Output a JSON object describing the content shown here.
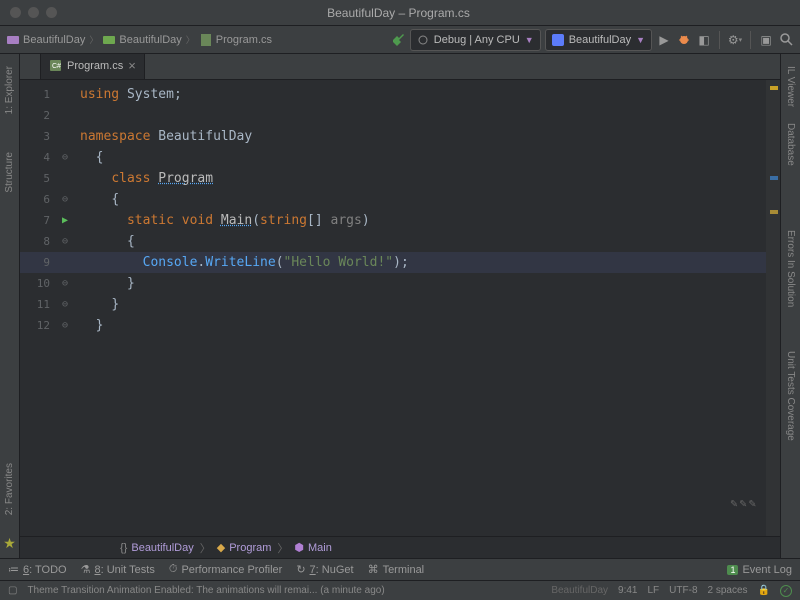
{
  "titlebar": {
    "title": "BeautifulDay – Program.cs"
  },
  "toolbar": {
    "breadcrumbs": [
      {
        "label": "BeautifulDay"
      },
      {
        "label": "BeautifulDay"
      },
      {
        "label": "Program.cs"
      }
    ],
    "config1": "Debug | Any CPU",
    "config2": "BeautifulDay"
  },
  "left_rail": {
    "explorer": "1: Explorer",
    "structure": "Structure",
    "favorites": "2: Favorites"
  },
  "right_rail": {
    "il": "IL Viewer",
    "db": "Database",
    "errors": "Errors In Solution",
    "tests": "Unit Tests Coverage"
  },
  "tab": {
    "label": "Program.cs"
  },
  "code": {
    "l1": {
      "kw": "using",
      "ns": " System",
      "semi": ";"
    },
    "l3": {
      "kw": "namespace",
      "ns": " BeautifulDay"
    },
    "l4": "{",
    "l5": {
      "kw": "class ",
      "name": "Program"
    },
    "l6": "{",
    "l7": {
      "k1": "static ",
      "k2": "void ",
      "m": "Main",
      "p1": "(",
      "t": "string",
      "br": "[]",
      "sp": " ",
      "arg": "args",
      "p2": ")"
    },
    "l8": "{",
    "l9": {
      "cls": "Console",
      "dot": ".",
      "m": "WriteLine",
      "p1": "(",
      "str": "\"Hello World!\"",
      "p2": ")",
      "semi": ";"
    },
    "l10": "}",
    "l11": "}",
    "l12": "}"
  },
  "line_numbers": [
    "1",
    "2",
    "3",
    "4",
    "5",
    "6",
    "7",
    "8",
    "9",
    "10",
    "11",
    "12"
  ],
  "code_nav": {
    "ns": "BeautifulDay",
    "cls": "Program",
    "m": "Main"
  },
  "bottom": {
    "todo": "6: TODO",
    "ut": "8: Unit Tests",
    "perf": "Performance Profiler",
    "nuget": "7: NuGet",
    "term": "Terminal",
    "eventlog": "Event Log"
  },
  "status": {
    "msg": "Theme Transition Animation Enabled: The animations will remai... (a minute ago)",
    "proj": "BeautifulDay",
    "pos": "9:41",
    "le": "LF",
    "enc": "UTF-8",
    "indent": "2 spaces"
  }
}
